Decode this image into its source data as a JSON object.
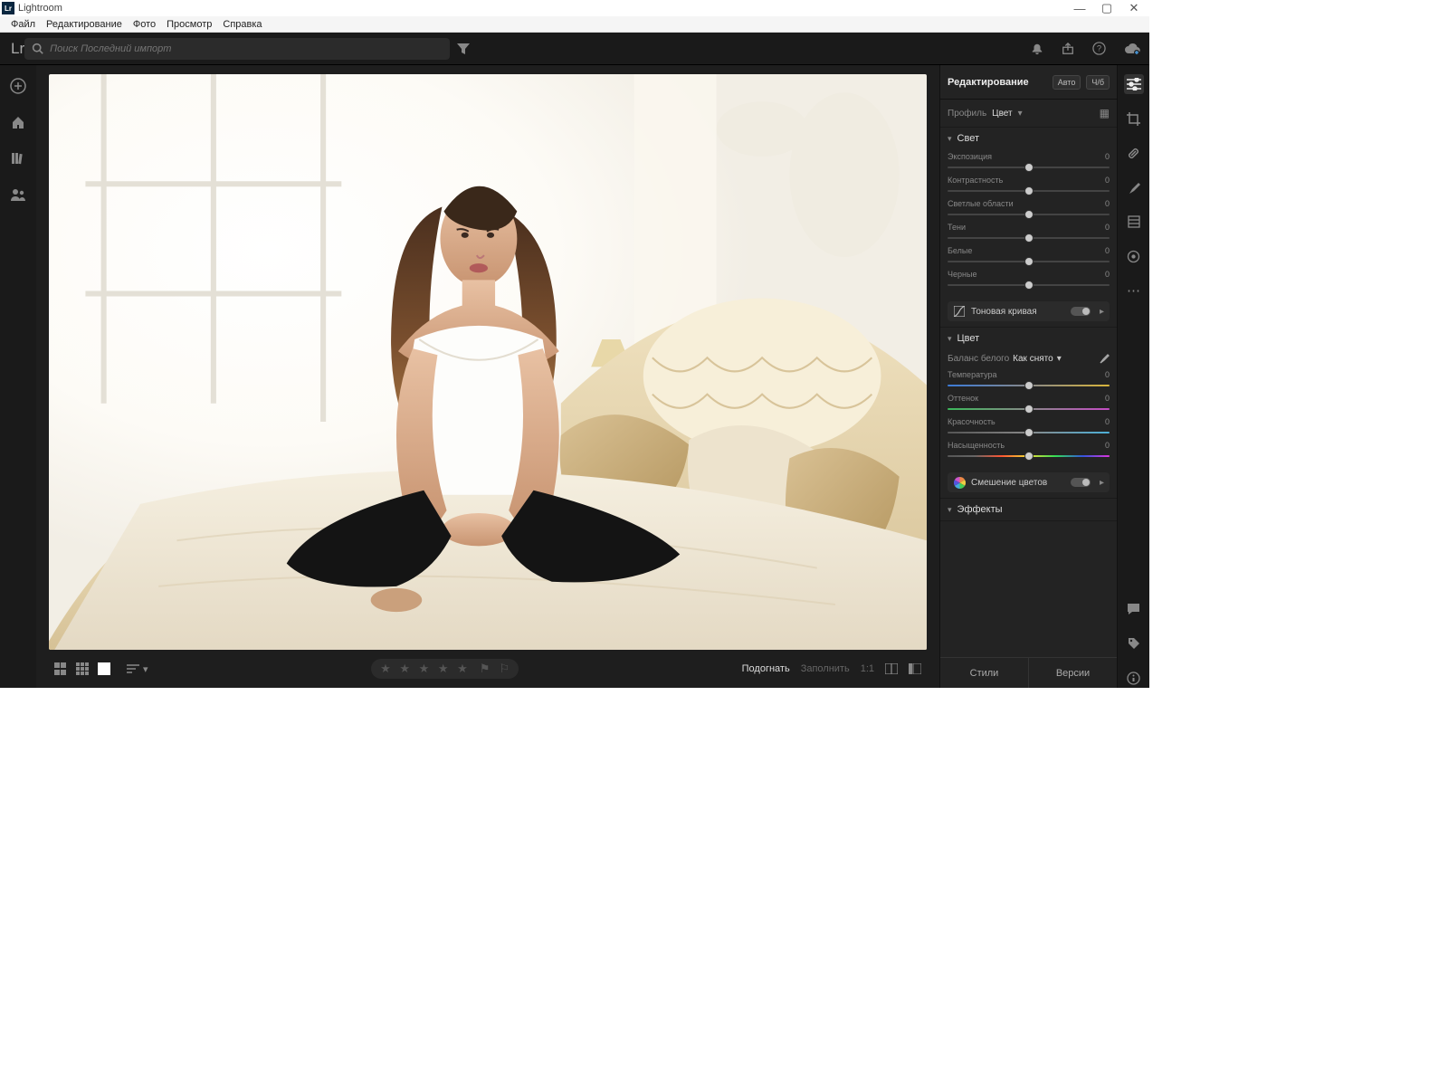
{
  "window": {
    "title": "Lightroom"
  },
  "menu": {
    "file": "Файл",
    "edit": "Редактирование",
    "photo": "Фото",
    "view": "Просмотр",
    "help": "Справка"
  },
  "topbar": {
    "logo_text": "Lr",
    "search_placeholder": "Поиск Последний импорт"
  },
  "leftrail": {
    "add": "plus",
    "home": "home",
    "library": "library",
    "share": "people"
  },
  "edit": {
    "title": "Редактирование",
    "auto": "Авто",
    "bw": "Ч/б",
    "profile_label": "Профиль",
    "profile_value": "Цвет",
    "sections": {
      "light": {
        "title": "Свет",
        "sliders": [
          {
            "name": "exposure",
            "label": "Экспозиция",
            "value": "0"
          },
          {
            "name": "contrast",
            "label": "Контрастность",
            "value": "0"
          },
          {
            "name": "highlights",
            "label": "Светлые области",
            "value": "0"
          },
          {
            "name": "shadows",
            "label": "Тени",
            "value": "0"
          },
          {
            "name": "whites",
            "label": "Белые",
            "value": "0"
          },
          {
            "name": "blacks",
            "label": "Черные",
            "value": "0"
          }
        ],
        "curve": "Тоновая кривая"
      },
      "color": {
        "title": "Цвет",
        "wb_label": "Баланс белого",
        "wb_value": "Как снято",
        "sliders": [
          {
            "name": "temp",
            "label": "Температура",
            "value": "0",
            "track": "temp"
          },
          {
            "name": "tint",
            "label": "Оттенок",
            "value": "0",
            "track": "tint"
          },
          {
            "name": "vibrance",
            "label": "Красочность",
            "value": "0",
            "track": "vib"
          },
          {
            "name": "saturation",
            "label": "Насыщенность",
            "value": "0",
            "track": "sat"
          }
        ],
        "mixer": "Смешение цветов"
      },
      "effects": {
        "title": "Эффекты"
      }
    },
    "foot": {
      "styles": "Стили",
      "versions": "Версии"
    }
  },
  "bottom": {
    "fit": "Подогнать",
    "fill": "Заполнить",
    "one": "1:1"
  }
}
